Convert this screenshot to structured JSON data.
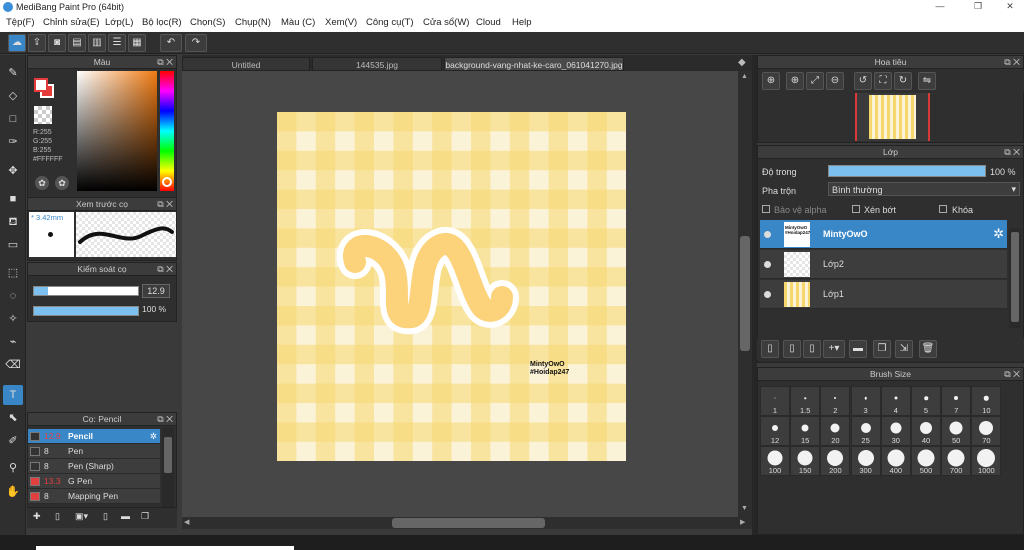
{
  "app": {
    "title": "MediBang Paint Pro (64bit)"
  },
  "window": {
    "minimize": "—",
    "restore": "❐",
    "close": "✕"
  },
  "menu": [
    "Tệp(F)",
    "Chỉnh sửa(E)",
    "Lớp(L)",
    "Bộ lọc(R)",
    "Chọn(S)",
    "Chụp(N)",
    "Màu (C)",
    "Xem(V)",
    "Công cụ(T)",
    "Cửa sổ(W)",
    "Cloud",
    "Help"
  ],
  "toolbar": {
    "undo": "↶",
    "redo": "↷"
  },
  "tabs": [
    {
      "label": "Untitled"
    },
    {
      "label": "144535.jpg"
    },
    {
      "label": "background-vang-nhat-ke-caro_061041270.jpg"
    }
  ],
  "color_panel": {
    "title": "Màu",
    "r": "R:255",
    "g": "G:255",
    "b": "B:255",
    "hex": "#FFFFFF"
  },
  "brush_preview": {
    "title": "Xem trước cọ",
    "size": "* 3.42mm"
  },
  "brush_control": {
    "title": "Kiểm soát cọ",
    "size_value": "12.9",
    "opacity_value": "100 %",
    "size_fraction": 0.13,
    "opacity_fraction": 1.0
  },
  "brush_list": {
    "title": "Cọ: Pencil",
    "items": [
      {
        "size": "12.9",
        "name": "Pencil",
        "color": "#e04040",
        "selected": true
      },
      {
        "size": "8",
        "name": "Pen",
        "color": "#333333",
        "selected": false
      },
      {
        "size": "8",
        "name": "Pen (Sharp)",
        "color": "#333333",
        "selected": false
      },
      {
        "size": "13.3",
        "name": "G Pen",
        "color": "#e04040",
        "selected": false
      },
      {
        "size": "8",
        "name": "Mapping Pen",
        "color": "#e04040",
        "selected": false
      }
    ]
  },
  "canvas": {
    "watermark_line1": "MintyOwO",
    "watermark_line2": "#Hoidap247"
  },
  "navigator": {
    "title": "Hoa tiêu"
  },
  "layer_panel": {
    "title": "Lớp",
    "opacity_label": "Độ trong",
    "opacity_value": "100 %",
    "opacity_fraction": 1.0,
    "blend_label": "Pha trộn",
    "blend_value": "Bình thường",
    "protect_alpha": "Bảo vệ alpha",
    "clipping": "Xén bớt",
    "lock": "Khóa",
    "layers": [
      {
        "name": "MintyOwO",
        "thumb_text": "MintyOwO #Hoidap247",
        "selected": true
      },
      {
        "name": "Lớp2",
        "selected": false
      },
      {
        "name": "Lớp1",
        "selected": false
      }
    ]
  },
  "brush_size": {
    "title": "Brush Size",
    "sizes": [
      "1",
      "1.5",
      "2",
      "3",
      "4",
      "5",
      "7",
      "10",
      "12",
      "15",
      "20",
      "25",
      "30",
      "40",
      "50",
      "70",
      "100",
      "150",
      "200",
      "300",
      "400",
      "500",
      "700",
      "1000"
    ]
  },
  "colors": {
    "accent": "#3a87c8",
    "panel": "#2f2f2f",
    "workarea": "#474747",
    "check_yellow": "#f5d76e"
  }
}
